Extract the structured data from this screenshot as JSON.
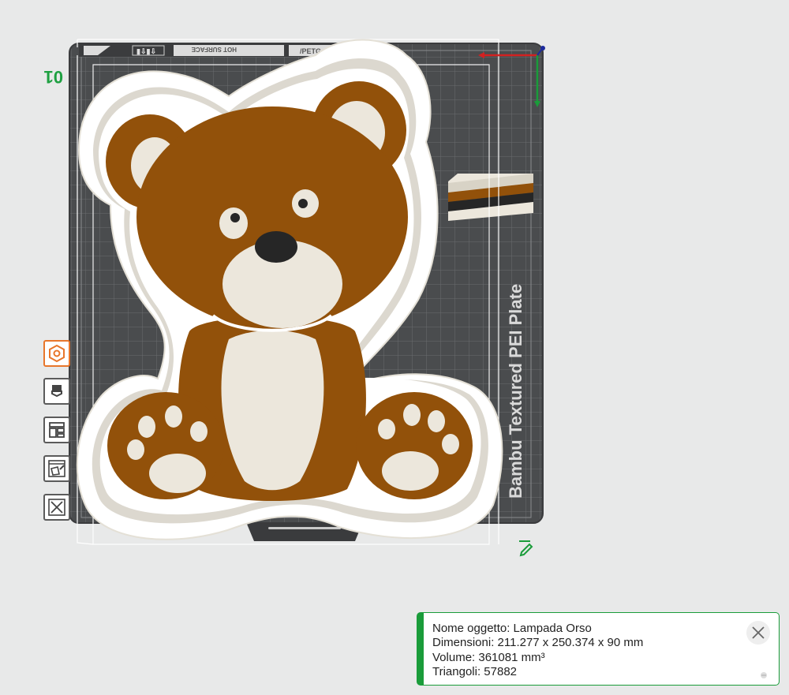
{
  "app": {
    "scene": "3d-viewport",
    "background_color": "#e8e9e9",
    "accent_color": "#1a9c3a",
    "active_color": "#e8762b"
  },
  "plate": {
    "name_label": "Bambu Textured PEI Plate",
    "id_label": "01",
    "top_strip_text_1": "HOT SURFACE",
    "top_strip_text_2": "/PETG",
    "plate_color": "#4a4c4e",
    "grid_color": "#6b6d70"
  },
  "model": {
    "subject": "teddy-bear-lamp",
    "colors": {
      "body": "#92510a",
      "cream": "#ece7dc",
      "nose": "#262626",
      "shell": "#ffffff",
      "wall": "#dcd8cf"
    }
  },
  "axes": {
    "x_color": "#d32121",
    "y_color": "#1a9c3a",
    "z_color": "#1d2b9c"
  },
  "toolbar": {
    "items": [
      {
        "name": "orient",
        "icon": "hexagon-icon",
        "active": true
      },
      {
        "name": "paint",
        "icon": "paint-bucket-icon",
        "active": false
      },
      {
        "name": "layout",
        "icon": "panels-icon",
        "active": false
      },
      {
        "name": "slice-view",
        "icon": "slice-icon",
        "active": false
      },
      {
        "name": "close",
        "icon": "close-icon",
        "active": false
      }
    ]
  },
  "info_panel": {
    "object_name": "Nome oggetto: Lampada Orso",
    "dimensions": "Dimensioni: 211.277 x 250.374 x 90 mm",
    "volume": "Volume: 361081 mm³",
    "triangles": "Triangoli: 57882"
  }
}
